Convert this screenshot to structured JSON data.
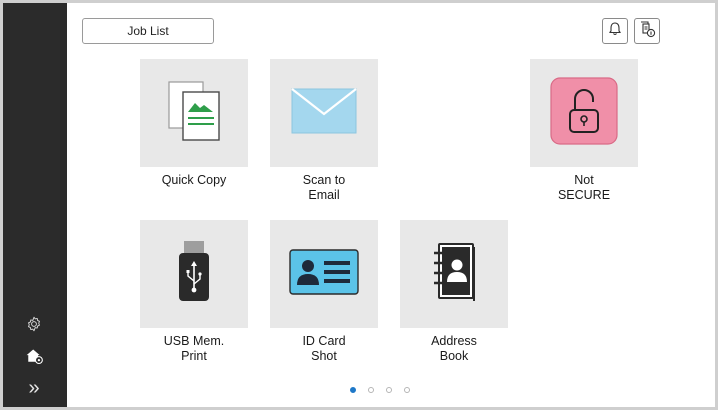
{
  "header": {
    "job_list_label": "Job List"
  },
  "icons": {
    "notification": "bell-icon",
    "job_status": "job-status-icon"
  },
  "tiles": [
    {
      "label": "Quick Copy",
      "icon": "quick-copy-icon"
    },
    {
      "label": "Scan to\nEmail",
      "icon": "envelope-icon"
    },
    {
      "label": "Not\nSECURE",
      "icon": "unlocked-padlock-icon",
      "accent": "#f08fa8"
    },
    {
      "label": "USB Mem.\nPrint",
      "icon": "usb-icon"
    },
    {
      "label": "ID Card\nShot",
      "icon": "id-card-icon",
      "accent": "#5bc3e8"
    },
    {
      "label": "Address\nBook",
      "icon": "address-book-icon"
    }
  ],
  "sidebar": {
    "items": [
      {
        "icon": "settings-gear-icon"
      },
      {
        "icon": "home-settings-icon"
      },
      {
        "icon": "expand-chevrons-icon",
        "glyph": "»"
      }
    ]
  },
  "pagination": {
    "pages": 4,
    "current": 1
  },
  "colors": {
    "sidebar": "#2b2b2b",
    "tile_bg": "#e8e8e8",
    "active_dot": "#1e78c8"
  }
}
